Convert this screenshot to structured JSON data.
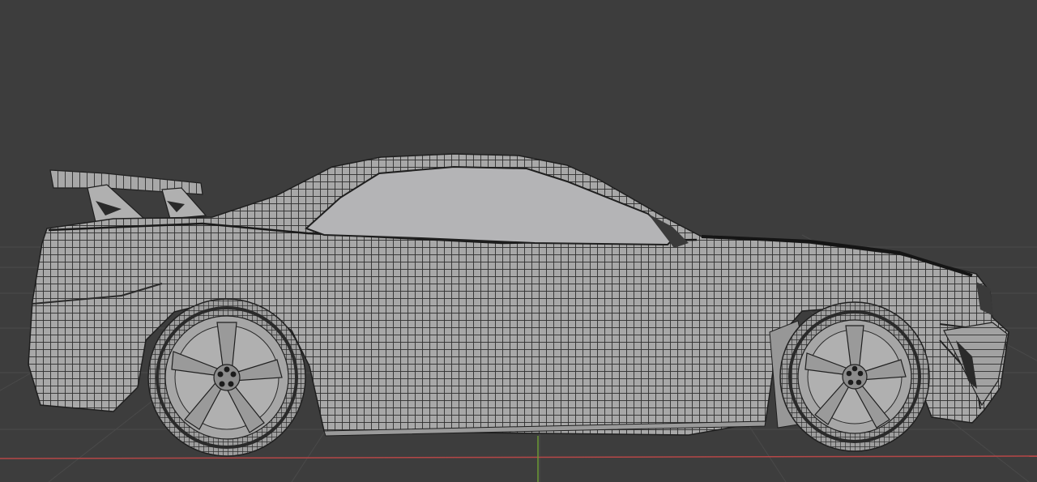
{
  "viewport": {
    "background": "#3d3d3d",
    "grid_color": "#4a4a4a",
    "x_axis_color": "#b54747",
    "y_axis_color": "#6b9a33"
  },
  "model": {
    "name": "car",
    "display": "wireframe",
    "body_color": "#a8a8a8",
    "glass_color": "#b4b4b6",
    "wire_color": "#2e2e2e",
    "parts": [
      "body",
      "window",
      "spoiler",
      "front-wheel",
      "rear-wheel"
    ]
  }
}
